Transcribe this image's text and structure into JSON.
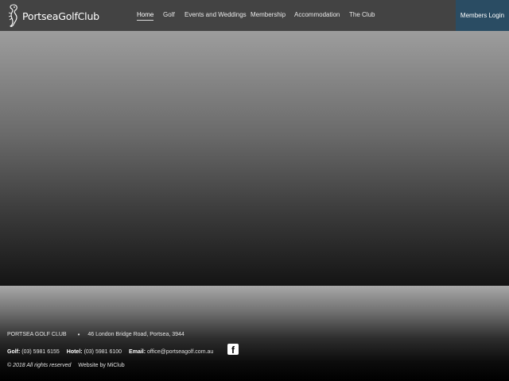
{
  "header": {
    "logo_text": "PortseaGolfClub",
    "nav": [
      {
        "label": "Home",
        "active": true
      },
      {
        "label": "Golf"
      },
      {
        "label": "Events and Weddings"
      },
      {
        "label": "Membership"
      },
      {
        "label": "Accommodation"
      },
      {
        "label": "The Club"
      }
    ],
    "members_login": "Members Login"
  },
  "footer": {
    "club_name": "PORTSEA GOLF CLUB",
    "bullet": "•",
    "address": "46 London Bridge Road, Portsea, 3944",
    "golf_label": "Golf:",
    "golf_phone": "(03) 5981 6155",
    "hotel_label": "Hotel:",
    "hotel_phone": "(03) 5981 6100",
    "email_label": "Email:",
    "email": "office@portseagolf.com.au",
    "facebook_icon": "facebook-icon",
    "copyright": "© 2018 All rights reserved",
    "website_by": "Website by MiClub"
  },
  "colors": {
    "header_bg": "#434343",
    "members_login_bg": "#2a4c63"
  }
}
